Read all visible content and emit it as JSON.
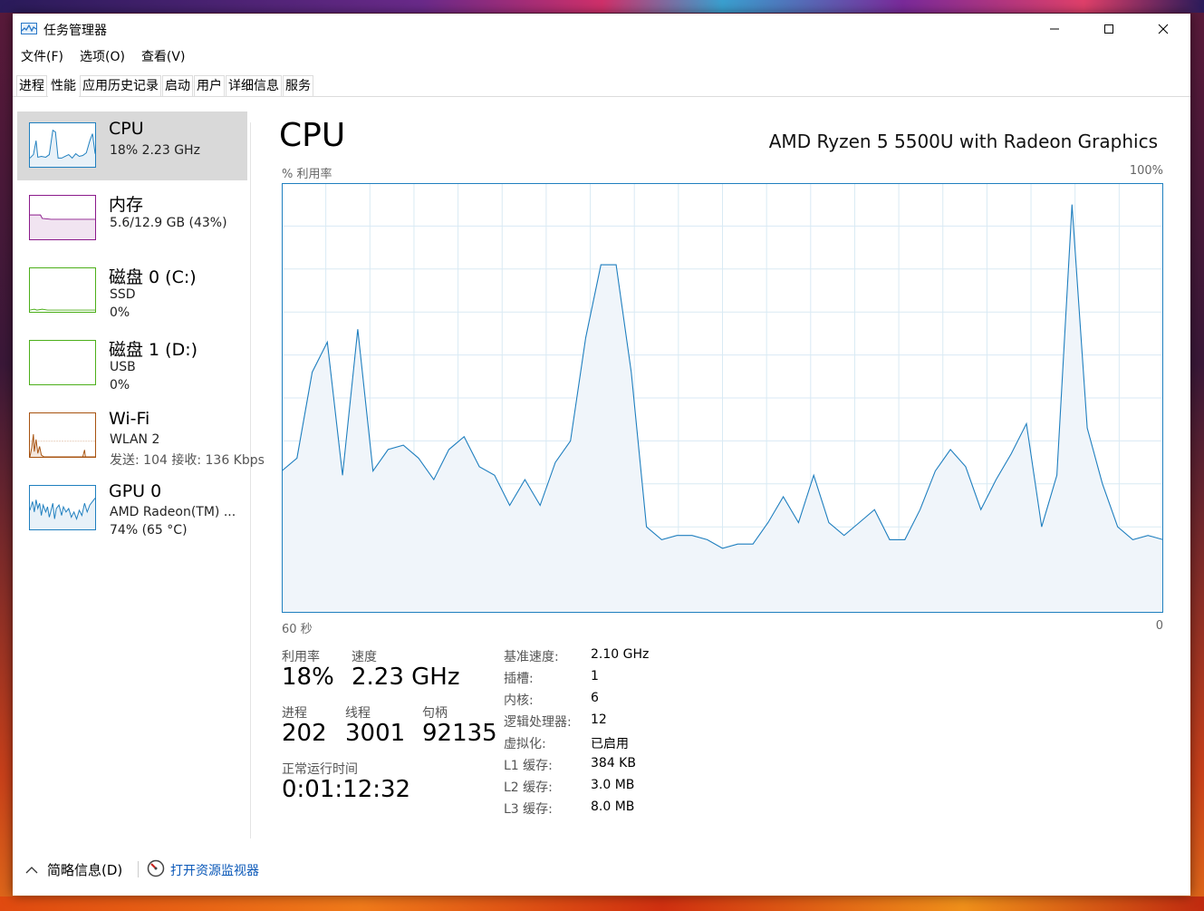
{
  "window": {
    "title": "任务管理器"
  },
  "menu": [
    "文件(F)",
    "选项(O)",
    "查看(V)"
  ],
  "tabs": [
    "进程",
    "性能",
    "应用历史记录",
    "启动",
    "用户",
    "详细信息",
    "服务"
  ],
  "active_tab": 1,
  "sidebar": [
    {
      "title": "CPU",
      "line1": "18%  2.23 GHz",
      "line2": "",
      "color": "#1f7fbf",
      "active": true
    },
    {
      "title": "内存",
      "line1": "5.6/12.9 GB (43%)",
      "line2": "",
      "color": "#8b1a8b",
      "active": false
    },
    {
      "title": "磁盘 0 (C:)",
      "line1": "SSD",
      "line2": "0%",
      "color": "#4caf1a",
      "active": false
    },
    {
      "title": "磁盘 1 (D:)",
      "line1": "USB",
      "line2": "0%",
      "color": "#4caf1a",
      "active": false
    },
    {
      "title": "Wi-Fi",
      "line1": "WLAN 2",
      "line2": "发送: 104  接收: 136 Kbps",
      "color": "#a7520f",
      "active": false
    },
    {
      "title": "GPU 0",
      "line1": "AMD Radeon(TM) ...",
      "line2": "74%  (65 °C)",
      "color": "#1f7fbf",
      "active": false
    }
  ],
  "main": {
    "title": "CPU",
    "cpu_name": "AMD Ryzen 5 5500U with Radeon Graphics",
    "y_label": "% 利用率",
    "y_max_label": "100%",
    "x_left_label": "60 秒",
    "x_right_label": "0"
  },
  "chart_data": {
    "type": "area",
    "title": "",
    "ylabel": "% 利用率",
    "ylim": [
      0,
      100
    ],
    "x_labels": [
      "60 秒",
      "0"
    ],
    "grid": true,
    "color": "#1f7fbf",
    "values": [
      33,
      36,
      56,
      63,
      32,
      66,
      33,
      38,
      39,
      36,
      31,
      38,
      41,
      34,
      32,
      25,
      31,
      25,
      35,
      40,
      64,
      81,
      81,
      56,
      20,
      17,
      18,
      18,
      17,
      15,
      16,
      16,
      21,
      27,
      21,
      32,
      21,
      18,
      21,
      24,
      17,
      17,
      24,
      33,
      38,
      34,
      24,
      31,
      37,
      44,
      20,
      32,
      95,
      43,
      30,
      20,
      17,
      18,
      17
    ]
  },
  "stats": {
    "util_label": "利用率",
    "util_value": "18%",
    "speed_label": "速度",
    "speed_value": "2.23 GHz",
    "proc_label": "进程",
    "proc_value": "202",
    "thread_label": "线程",
    "thread_value": "3001",
    "handle_label": "句柄",
    "handle_value": "92135",
    "uptime_label": "正常运行时间",
    "uptime_value": "0:01:12:32"
  },
  "info": [
    {
      "k": "基准速度:",
      "v": "2.10 GHz"
    },
    {
      "k": "插槽:",
      "v": "1"
    },
    {
      "k": "内核:",
      "v": "6"
    },
    {
      "k": "逻辑处理器:",
      "v": "12"
    },
    {
      "k": "虚拟化:",
      "v": "已启用"
    },
    {
      "k": "L1 缓存:",
      "v": "384 KB"
    },
    {
      "k": "L2 缓存:",
      "v": "3.0 MB"
    },
    {
      "k": "L3 缓存:",
      "v": "8.0 MB"
    }
  ],
  "footer": {
    "fewer_details": "简略信息(D)",
    "resource_monitor": "打开资源监视器"
  }
}
